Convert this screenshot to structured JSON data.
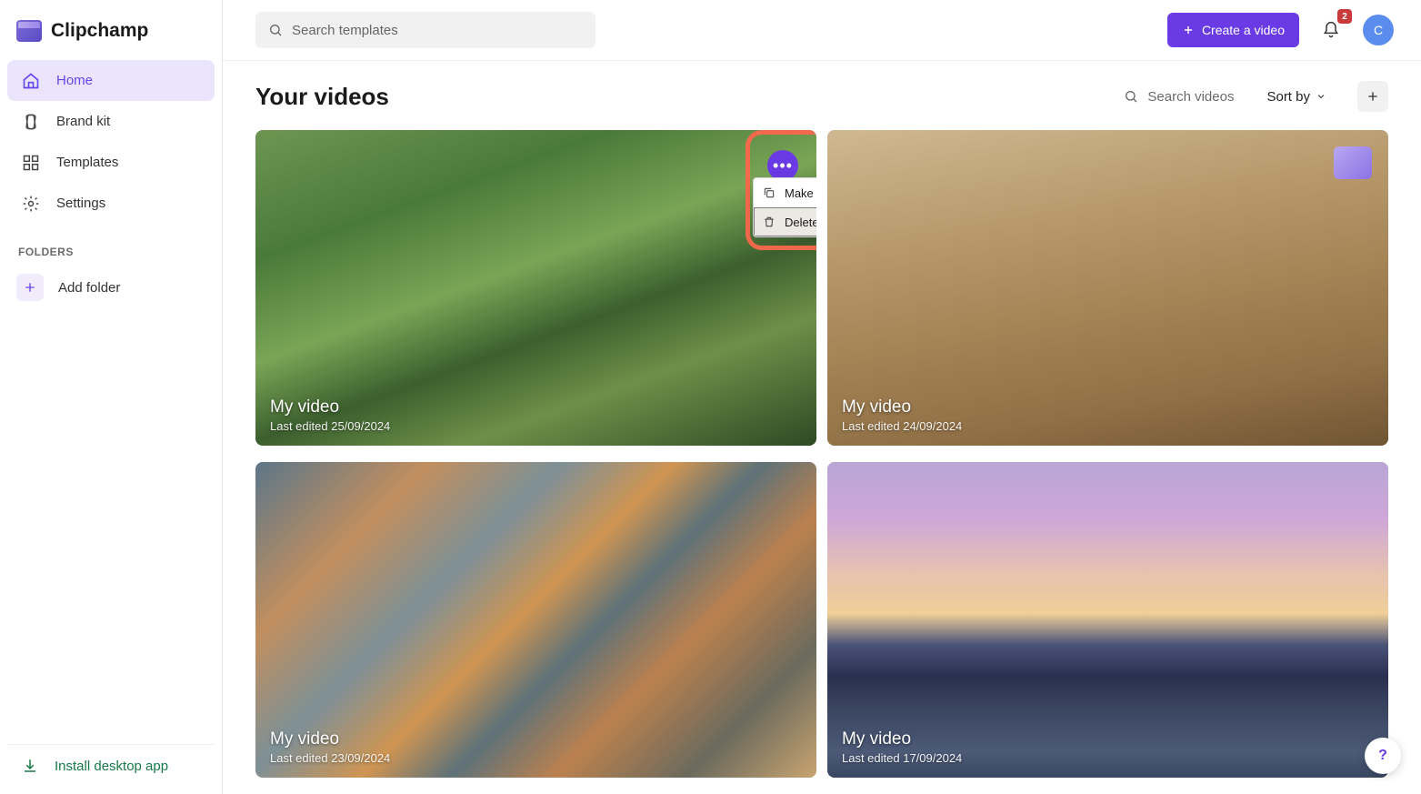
{
  "app_name": "Clipchamp",
  "sidebar": {
    "nav": [
      {
        "label": "Home",
        "icon": "home-icon",
        "active": true
      },
      {
        "label": "Brand kit",
        "icon": "brandkit-icon",
        "active": false
      },
      {
        "label": "Templates",
        "icon": "templates-icon",
        "active": false
      },
      {
        "label": "Settings",
        "icon": "settings-icon",
        "active": false
      }
    ],
    "folders_label": "FOLDERS",
    "add_folder_label": "Add folder",
    "install_label": "Install desktop app"
  },
  "topbar": {
    "search_placeholder": "Search templates",
    "create_label": "Create a video",
    "notification_count": "2",
    "avatar_initial": "C"
  },
  "content": {
    "title": "Your videos",
    "search_label": "Search videos",
    "sort_label": "Sort by",
    "videos": [
      {
        "title": "My video",
        "subtitle": "Last edited 25/09/2024",
        "thumb": "green",
        "has_menu": true
      },
      {
        "title": "My video",
        "subtitle": "Last edited 24/09/2024",
        "thumb": "people",
        "has_logo": true
      },
      {
        "title": "My video",
        "subtitle": "Last edited 23/09/2024",
        "thumb": "rock"
      },
      {
        "title": "My video",
        "subtitle": "Last edited 17/09/2024",
        "thumb": "mountain"
      }
    ],
    "context_menu": {
      "copy_label": "Make a copy",
      "delete_label": "Delete"
    }
  },
  "help_label": "?"
}
